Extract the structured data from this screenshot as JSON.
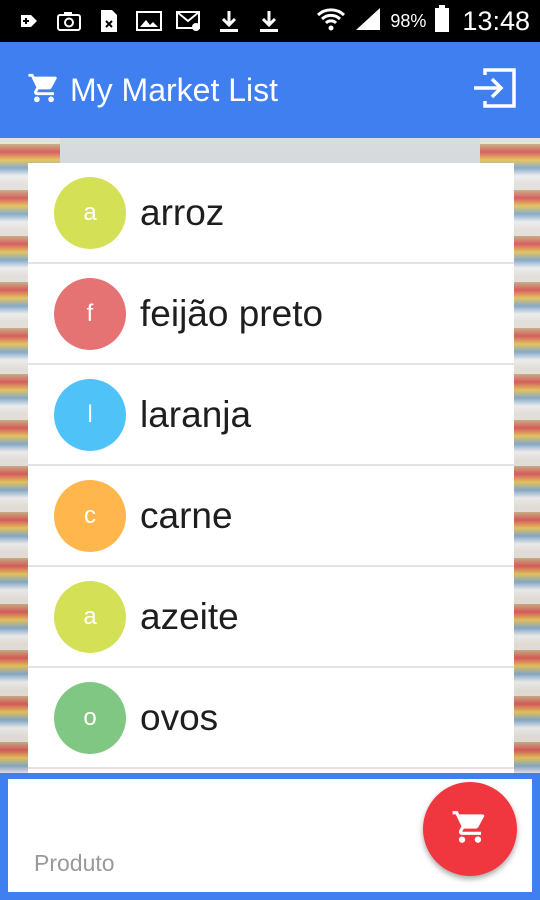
{
  "status_bar": {
    "battery_percent": "98%",
    "time": "13:48",
    "icons": [
      "add-notification-icon",
      "camera-icon",
      "file-icon",
      "image-icon",
      "email-icon",
      "download-icon",
      "download-icon",
      "wifi-icon",
      "signal-icon",
      "battery-icon"
    ]
  },
  "app_bar": {
    "title": "My Market List",
    "title_icon": "shopping-cart-icon",
    "action_icon": "logout-icon",
    "color": "#3f7ff0"
  },
  "list": {
    "items": [
      {
        "initial": "a",
        "label": "arroz",
        "color": "#d4e157"
      },
      {
        "initial": "f",
        "label": "feijão preto",
        "color": "#e57373"
      },
      {
        "initial": "l",
        "label": "laranja",
        "color": "#4fc3f7"
      },
      {
        "initial": "c",
        "label": "carne",
        "color": "#ffb74d"
      },
      {
        "initial": "a",
        "label": "azeite",
        "color": "#d4e157"
      },
      {
        "initial": "o",
        "label": "ovos",
        "color": "#81c784"
      }
    ]
  },
  "input": {
    "placeholder": "Produto",
    "value": ""
  },
  "fab": {
    "icon": "add-to-cart-icon",
    "color": "#f0363f"
  }
}
